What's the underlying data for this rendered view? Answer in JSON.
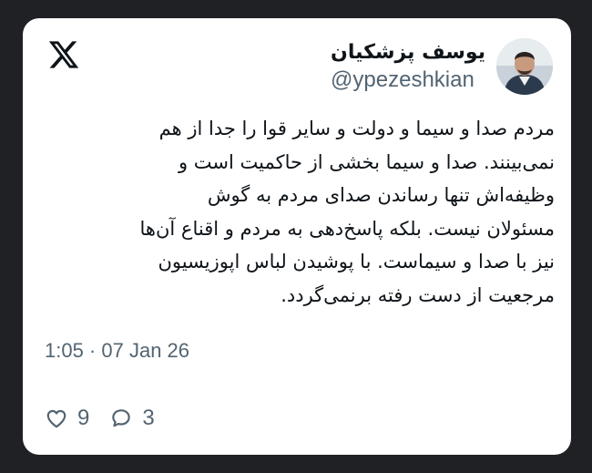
{
  "tweet": {
    "author": {
      "display_name": "یوسف پزشکیان",
      "handle": "@ypezeshkian"
    },
    "text_lines": [
      "مردم صدا و سیما و دولت و سایر قوا را جدا از هم",
      "نمی‌بینند. صدا و سیما بخشی از حاکمیت است و",
      "وظیفه‌اش تنها رساندن صدای مردم به گوش",
      "مسئولان نیست. بلکه پاسخ‌دهی به مردم و اقناع آن‌ها",
      "نیز با صدا و سیماست. با پوشیدن لباس اپوزیسیون",
      "مرجعیت از دست رفته برنمی‌گردد."
    ],
    "timestamp": "1:05 · 07 Jan 26",
    "stats": {
      "likes": "9",
      "replies": "3"
    }
  },
  "icons": {
    "brand": "x-logo-icon",
    "like": "heart-icon",
    "reply": "speech-bubble-icon"
  },
  "colors": {
    "card": "#ffffff",
    "text": "#0f1419",
    "secondary": "#536471",
    "background": "#202124"
  }
}
